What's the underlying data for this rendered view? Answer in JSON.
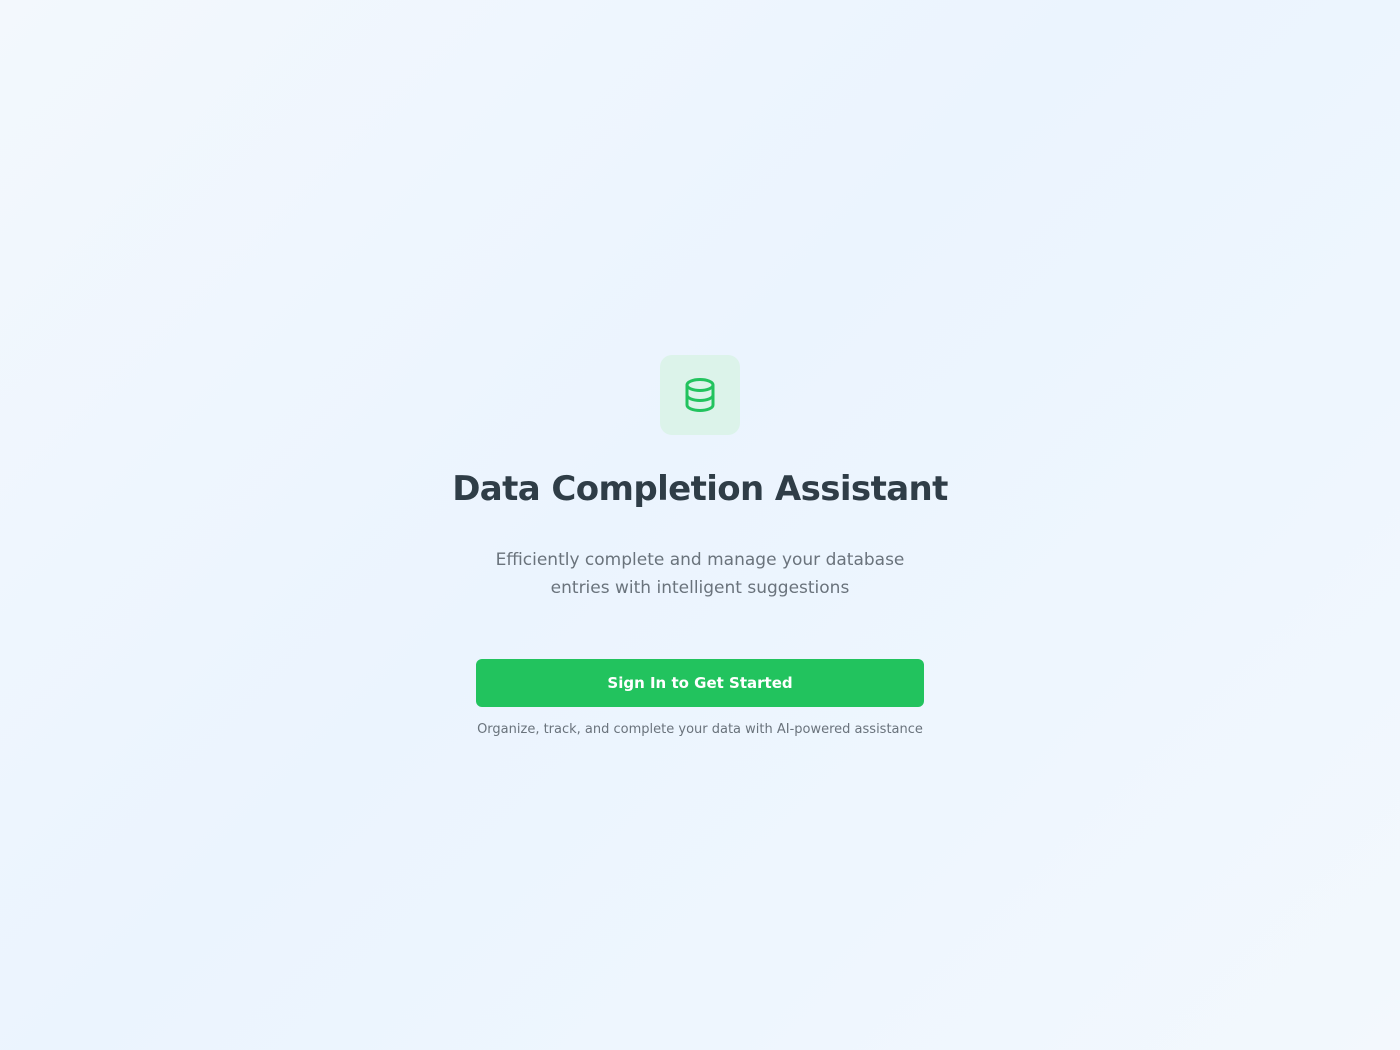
{
  "app": {
    "title": "Data Completion Assistant",
    "subtitle": "Efficiently complete and manage your database entries with intelligent suggestions",
    "logo_icon": "database-icon"
  },
  "actions": {
    "sign_in_label": "Sign In to Get Started"
  },
  "footer": {
    "tagline": "Organize, track, and complete your data with AI-powered assistance"
  },
  "colors": {
    "accent": "#22c35e",
    "icon_tile": "#dcf3ea",
    "title_text": "#2f3d47",
    "muted_text": "#6a737c",
    "background": "#eef6fe"
  }
}
